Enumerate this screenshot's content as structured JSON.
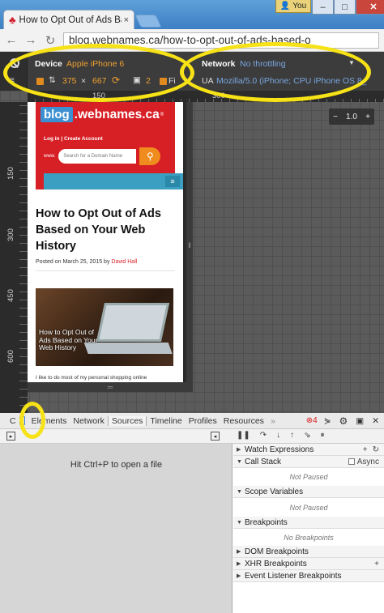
{
  "browser": {
    "tab_title": "How to Opt Out of Ads Ba",
    "tab_close": "×",
    "user_badge": "You",
    "address": "blog.webnames.ca/how-to-opt-out-of-ads-based-o",
    "window_controls": [
      "–",
      "□",
      "✕"
    ]
  },
  "device_toolbar": {
    "device_label": "Device",
    "device_value": "Apple iPhone 6",
    "network_label": "Network",
    "network_value": "No throttling",
    "width": "375",
    "times": "×",
    "height": "667",
    "dpr": "2",
    "fit_label": "Fi",
    "ua_label": "UA",
    "ua_value": "Mozilla/5.0 (iPhone; CPU iPhone OS 8_"
  },
  "rulers": {
    "h_ticks": [
      "150",
      "300"
    ],
    "v_ticks": [
      "150",
      "300",
      "450",
      "600"
    ],
    "zoom_value": "1.0",
    "zoom_minus": "−",
    "zoom_plus": "+"
  },
  "page": {
    "logo_blog": "blog",
    "logo_name": ".webnames.ca",
    "logo_tm": "®",
    "login": "Log in",
    "separator": "|",
    "create": "Create Account",
    "www": "www.",
    "search_placeholder": "Search for a Domain Name",
    "title": "How to Opt Out of Ads Based on Your Web History",
    "posted_on": "Posted on March 25, 2015 by",
    "author": "David Hall",
    "thumb_text": "How to Opt Out of Ads Based on Your Web History",
    "body_start": "I like to do most of my personal shopping online"
  },
  "devtools": {
    "tabs": [
      "Elements",
      "Network",
      "Sources",
      "Timeline",
      "Profiles",
      "Resources",
      "»"
    ],
    "active_tab": "Sources",
    "prefix": "C",
    "error_count": "4",
    "hint": "Hit Ctrl+P to open a file",
    "sections": {
      "watch": "Watch Expressions",
      "callstack": "Call Stack",
      "async": "Async",
      "not_paused_1": "Not Paused",
      "scope": "Scope Variables",
      "not_paused_2": "Not Paused",
      "breakpoints": "Breakpoints",
      "no_breakpoints": "No Breakpoints",
      "dom": "DOM Breakpoints",
      "xhr": "XHR Breakpoints",
      "listener": "Event Listener Breakpoints"
    }
  }
}
